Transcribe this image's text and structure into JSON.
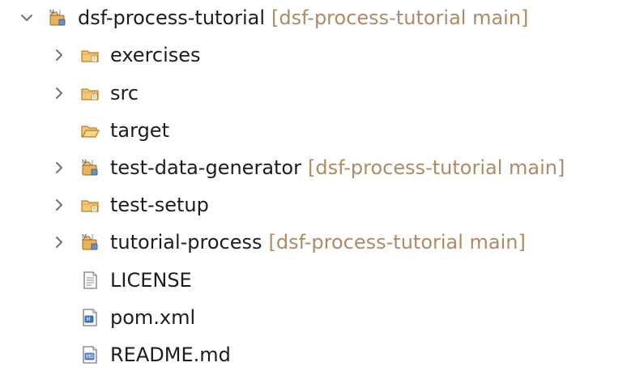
{
  "tree": {
    "root": {
      "label": "dsf-process-tutorial",
      "repo": "[dsf-process-tutorial main]",
      "expanded": true,
      "icon": "maven-project-icon",
      "children": [
        {
          "label": "exercises",
          "icon": "folder-icon",
          "expanded": false
        },
        {
          "label": "src",
          "icon": "folder-icon",
          "expanded": false
        },
        {
          "label": "target",
          "icon": "open-folder-icon",
          "expanded": false
        },
        {
          "label": "test-data-generator",
          "repo": "[dsf-process-tutorial main]",
          "icon": "maven-project-icon",
          "expanded": false
        },
        {
          "label": "test-setup",
          "icon": "folder-icon",
          "expanded": false
        },
        {
          "label": "tutorial-process",
          "repo": "[dsf-process-tutorial main]",
          "icon": "maven-project-icon",
          "expanded": false
        },
        {
          "label": "LICENSE",
          "icon": "text-file-icon"
        },
        {
          "label": "pom.xml",
          "icon": "maven-pom-icon"
        },
        {
          "label": "README.md",
          "icon": "markdown-file-icon"
        }
      ]
    }
  },
  "colors": {
    "text": "#1d1d1d",
    "repo": "#b08a63",
    "folder": "#e6b25d",
    "chevron": "#808080"
  }
}
